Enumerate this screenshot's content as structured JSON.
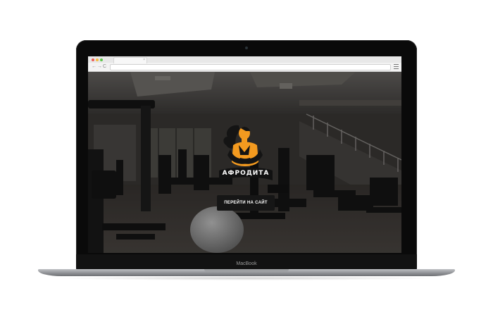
{
  "browser": {
    "tab_close": "×",
    "nav_back": "←",
    "nav_forward": "→",
    "nav_reload": "C"
  },
  "site": {
    "brand_name": "АФРОДИТА",
    "cta_label": "ПЕРЕЙТИ НА САЙТ"
  },
  "device": {
    "model_label": "MacBook"
  },
  "colors": {
    "brand_orange": "#f39a1f",
    "cta_background": "#161616"
  },
  "icons": {
    "logo": "woman-silhouette-logo",
    "menu": "hamburger-menu-icon"
  }
}
